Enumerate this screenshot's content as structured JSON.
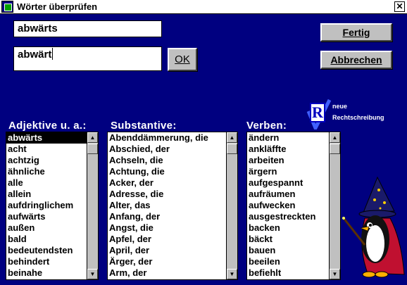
{
  "window": {
    "title": "Wörter überprüfen",
    "close_glyph": "✕"
  },
  "inputs": {
    "word_value": "abwärts",
    "entry_value": "abwärt"
  },
  "buttons": {
    "ok": "OK",
    "fertig": "Fertig",
    "abbrechen": "Abbrechen"
  },
  "logo": {
    "letter": "R",
    "line1": "neue",
    "line2": "Rechtschreibung"
  },
  "lists": {
    "adjektive": {
      "heading": "Adjektive u. a.:",
      "selected_index": 0,
      "items": [
        "abwärts",
        "acht",
        "achtzig",
        "ähnliche",
        "alle",
        "allein",
        "aufdringlichem",
        "aufwärts",
        "außen",
        "bald",
        "bedeutendsten",
        "behindert",
        "beinahe"
      ]
    },
    "substantive": {
      "heading": "Substantive:",
      "items": [
        "Abenddämmerung, die",
        "Abschied, der",
        "Achseln, die",
        "Achtung, die",
        "Acker, der",
        "Adresse, die",
        "Alter, das",
        "Anfang, der",
        "Angst, die",
        "Apfel, der",
        "April, der",
        "Ärger, der",
        "Arm, der"
      ]
    },
    "verben": {
      "heading": "Verben:",
      "items": [
        "ändern",
        "ankläffte",
        "arbeiten",
        "ärgern",
        "aufgespannt",
        "aufräumen",
        "aufwecken",
        "ausgestreckten",
        "backen",
        "bäckt",
        "bauen",
        "beeilen",
        "befiehlt"
      ]
    }
  },
  "icons": {
    "app": "app-icon",
    "close": "close-icon",
    "scroll_up": "scroll-up-arrow-icon",
    "scroll_down": "scroll-down-arrow-icon",
    "mascot": "penguin-wizard-icon",
    "logo": "rechtschreibung-logo-icon"
  },
  "scroll": {
    "up_glyph": "▲",
    "down_glyph": "▼"
  }
}
